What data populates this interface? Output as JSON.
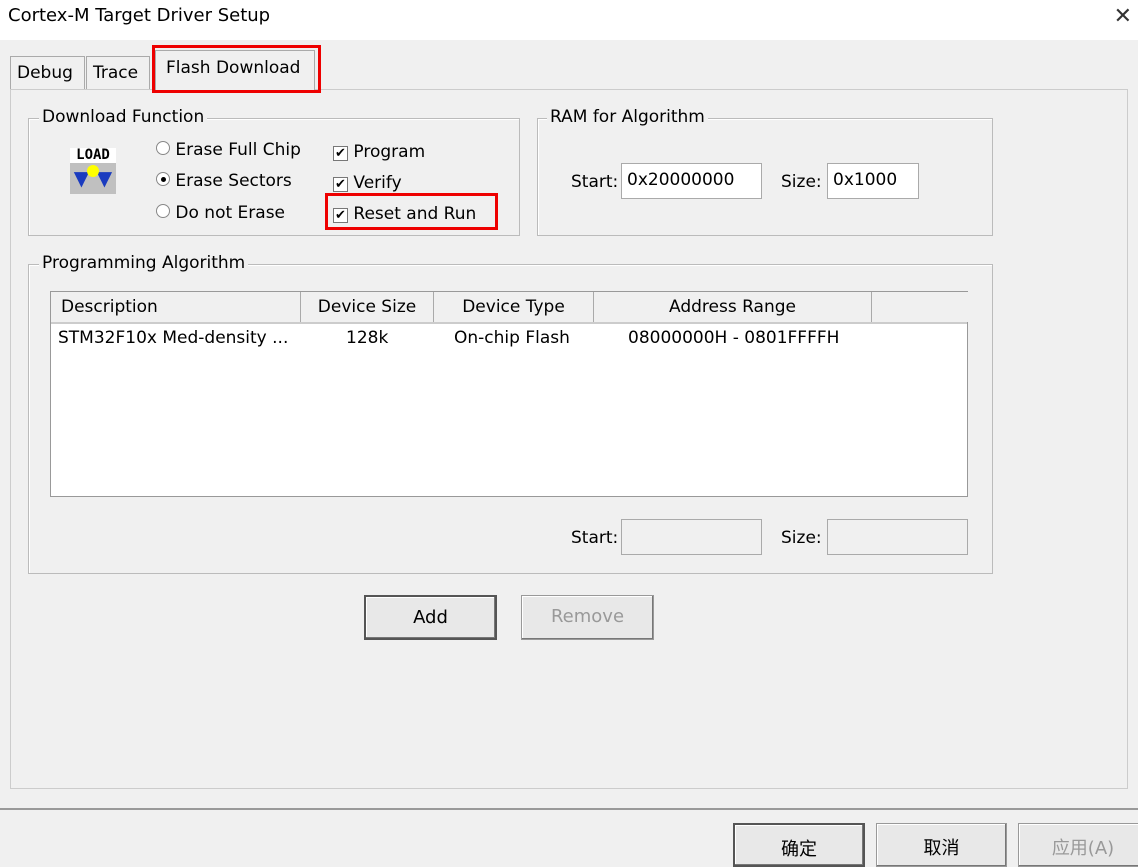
{
  "window": {
    "title": "Cortex-M Target Driver Setup"
  },
  "tabs": [
    {
      "label": "Debug"
    },
    {
      "label": "Trace"
    },
    {
      "label": "Flash Download",
      "active": true
    }
  ],
  "download_function": {
    "label": "Download Function",
    "icon": "load-icon",
    "icon_text": "LOAD",
    "erase_options": [
      {
        "label": "Erase Full Chip",
        "selected": false
      },
      {
        "label": "Erase Sectors",
        "selected": true
      },
      {
        "label": "Do not Erase",
        "selected": false
      }
    ],
    "checks": [
      {
        "label": "Program",
        "checked": true
      },
      {
        "label": "Verify",
        "checked": true
      },
      {
        "label": "Reset and Run",
        "checked": true
      }
    ]
  },
  "ram": {
    "label": "RAM for Algorithm",
    "start_label": "Start:",
    "start": "0x20000000",
    "size_label": "Size:",
    "size": "0x1000"
  },
  "algorithm": {
    "label": "Programming Algorithm",
    "columns": [
      "Description",
      "Device Size",
      "Device Type",
      "Address Range"
    ],
    "rows": [
      [
        "STM32F10x Med-density ...",
        "128k",
        "On-chip Flash",
        "08000000H - 0801FFFFH"
      ]
    ],
    "start_label": "Start:",
    "start": "",
    "size_label": "Size:",
    "size": ""
  },
  "buttons": {
    "add": "Add",
    "remove": "Remove",
    "ok": "确定",
    "cancel": "取消",
    "apply": "应用(A)"
  },
  "highlight_color": "#e00000"
}
